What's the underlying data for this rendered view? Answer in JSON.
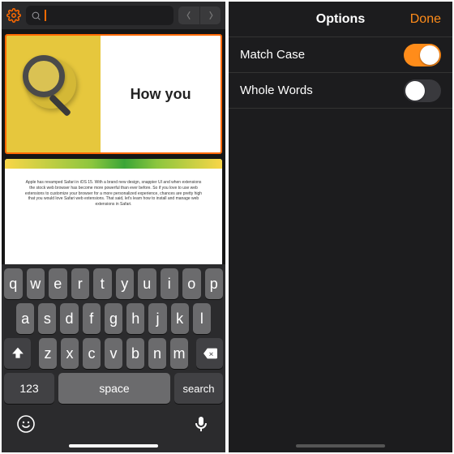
{
  "left": {
    "search": {
      "value": ""
    },
    "slide1": {
      "title": "How you"
    },
    "slide2": {
      "paragraph": "Apple has revamped Safari in iOS 15. With a brand new design, snappier UI and when extensions the stock web browser has become more powerful than ever before. So if you love to use web extensions to customize your browser for a more personalized experience, chances are pretty high that you would love Safari web extensions. That said, let's learn how to install and manage web extensions in Safari."
    },
    "keyboard": {
      "row1": [
        "q",
        "w",
        "e",
        "r",
        "t",
        "y",
        "u",
        "i",
        "o",
        "p"
      ],
      "row2": [
        "a",
        "s",
        "d",
        "f",
        "g",
        "h",
        "j",
        "k",
        "l"
      ],
      "row3": [
        "z",
        "x",
        "c",
        "v",
        "b",
        "n",
        "m"
      ],
      "numKey": "123",
      "spaceKey": "space",
      "searchKey": "search"
    }
  },
  "right": {
    "title": "Options",
    "done": "Done",
    "options": [
      {
        "label": "Match Case",
        "on": true
      },
      {
        "label": "Whole Words",
        "on": false
      }
    ]
  }
}
